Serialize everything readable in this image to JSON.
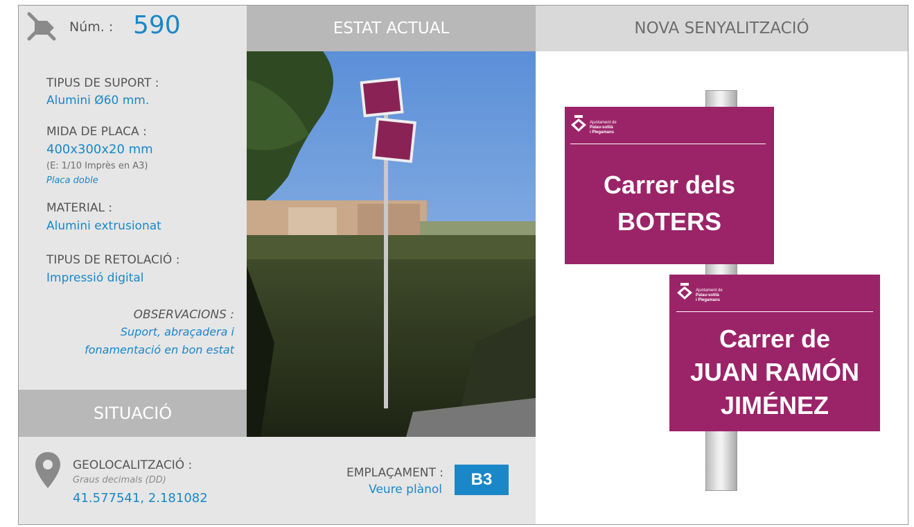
{
  "header": {
    "num_label": "Núm. :",
    "num_value": "590",
    "estat_actual": "ESTAT ACTUAL",
    "nova_senyalitzacio": "NOVA SENYALITZACIÓ"
  },
  "specs": {
    "tipus_suport_label": "TIPUS DE SUPORT :",
    "tipus_suport_value": "Alumini Ø60 mm.",
    "mida_placa_label": "MIDA DE PLACA :",
    "mida_placa_value": "400x300x20 mm",
    "mida_placa_escala": "(E: 1/10 Imprès en A3)",
    "mida_placa_tipus": "Placa doble",
    "material_label": "MATERIAL :",
    "material_value": "Alumini extrusionat",
    "retolacio_label": "TIPUS DE RETOLACIÓ :",
    "retolacio_value": "Impressió digital",
    "observacions_label": "OBSERVACIONS :",
    "observacions_line1": "Suport, abraçadera i",
    "observacions_line2": "fonamentació en bon estat"
  },
  "situacio": {
    "title": "SITUACIÓ",
    "geo_label": "GEOLOCALITZACIÓ :",
    "geo_format": "Graus decimals (DD)",
    "geo_coords": "41.577541, 2.181082",
    "emplacament_label": "EMPLAÇAMENT :",
    "emplacament_link": "Veure plànol",
    "emplacament_code": "B3"
  },
  "signs": {
    "logo_line1": "Ajuntament de",
    "logo_line2": "Palau-solità",
    "logo_line3": "i Plegamans",
    "top_line1": "Carrer dels",
    "top_line2": "BOTERS",
    "bottom_line1": "Carrer de",
    "bottom_line2": "JUAN RAMÓN",
    "bottom_line3": "JIMÉNEZ"
  },
  "icons": {
    "header_icon": "sign-pointer-icon",
    "location_icon": "map-pin-icon"
  },
  "colors": {
    "accent_blue": "#1a87c9",
    "sign_magenta": "#9b2468",
    "bar_gray": "#b8b8b8",
    "panel_gray": "#e6e6e6"
  }
}
